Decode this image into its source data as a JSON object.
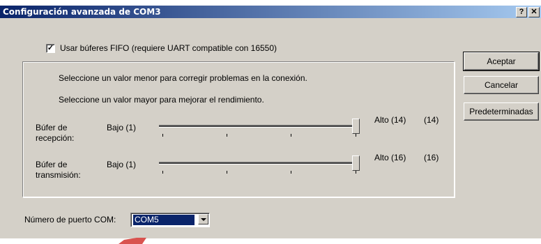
{
  "window": {
    "title": "Configuración avanzada de COM3",
    "help_label": "?",
    "close_label": "✕"
  },
  "fifo": {
    "checked": true,
    "label": "Usar búferes FIFO (requiere UART compatible con 16550)"
  },
  "group": {
    "hint_lower": "Seleccione un valor menor para corregir problemas en la conexión.",
    "hint_higher": "Seleccione un valor mayor para mejorar el rendimiento."
  },
  "receive": {
    "label": "Búfer de recepción:",
    "low_label": "Bajo (1)",
    "high_label": "Alto (14)",
    "value_label": "(14)",
    "value": 14,
    "max": 14
  },
  "transmit": {
    "label": "Búfer de transmisión:",
    "low_label": "Bajo (1)",
    "high_label": "Alto (16)",
    "value_label": "(16)",
    "value": 16,
    "max": 16
  },
  "com_port": {
    "label": "Número de puerto COM:",
    "selected": "COM5"
  },
  "buttons": {
    "ok": "Aceptar",
    "cancel": "Cancelar",
    "defaults": "Predeterminadas"
  },
  "colors": {
    "title_gradient_start": "#0a246a",
    "title_gradient_end": "#a6caf0",
    "dialog_bg": "#d4d0c8",
    "selection": "#0a246a",
    "annotation_arrow": "#d9534f"
  }
}
